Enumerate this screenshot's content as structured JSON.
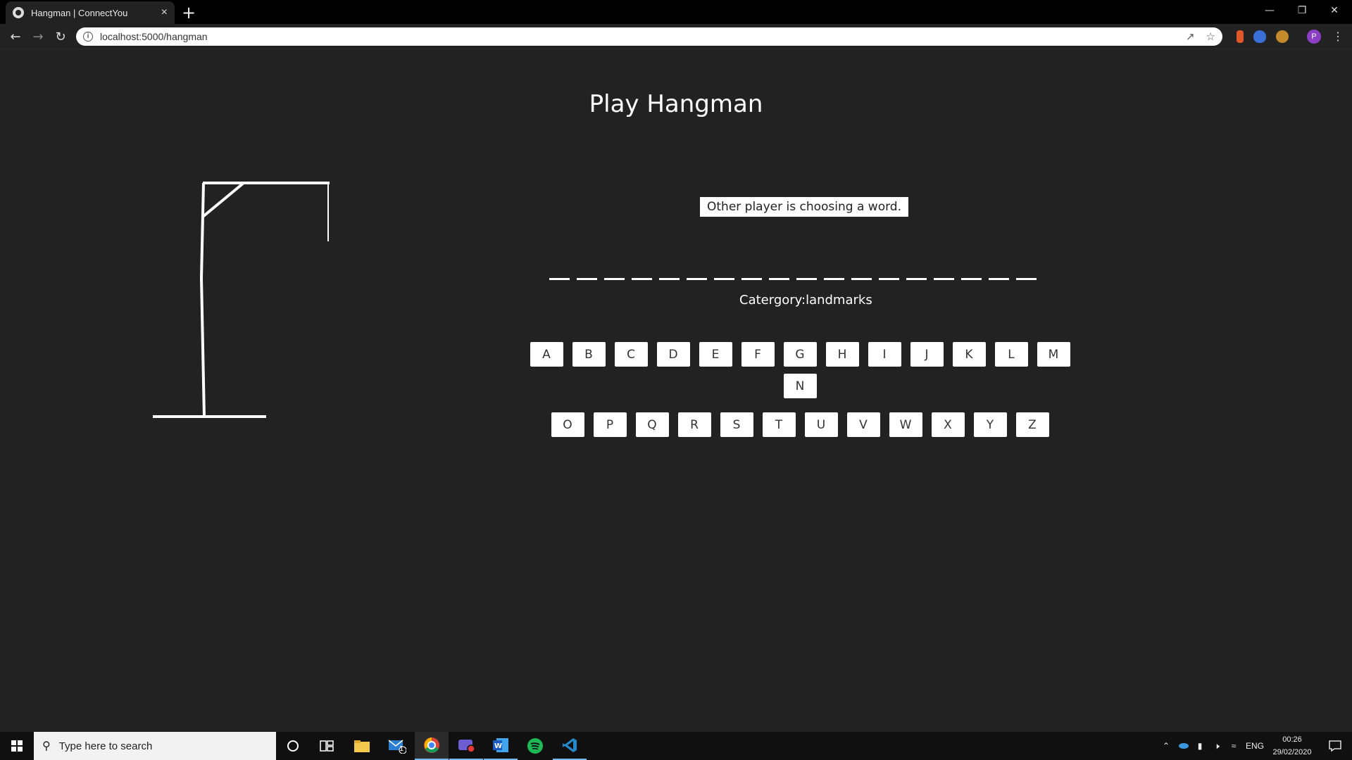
{
  "browser": {
    "tab_title": "Hangman | ConnectYou",
    "tab_close": "×",
    "new_tab": "+",
    "url": "localhost:5000/hangman",
    "profile_initial": "P"
  },
  "page": {
    "title": "Play Hangman",
    "status_message": "Other player is choosing a word.",
    "word_length": 18,
    "category_label": "Catergory:",
    "category_value": "landmarks",
    "letters_row1": [
      "A",
      "B",
      "C",
      "D",
      "E",
      "F",
      "G",
      "H",
      "I",
      "J",
      "K",
      "L",
      "M",
      "N"
    ],
    "letters_row2": [
      "O",
      "P",
      "Q",
      "R",
      "S",
      "T",
      "U",
      "V",
      "W",
      "X",
      "Y",
      "Z"
    ]
  },
  "taskbar": {
    "search_placeholder": "Type here to search",
    "mail_badge": "1",
    "language": "ENG",
    "time": "00:26",
    "date": "29/02/2020"
  },
  "colors": {
    "background": "#222222",
    "foreground": "#ffffff",
    "button_bg": "#ffffff"
  }
}
